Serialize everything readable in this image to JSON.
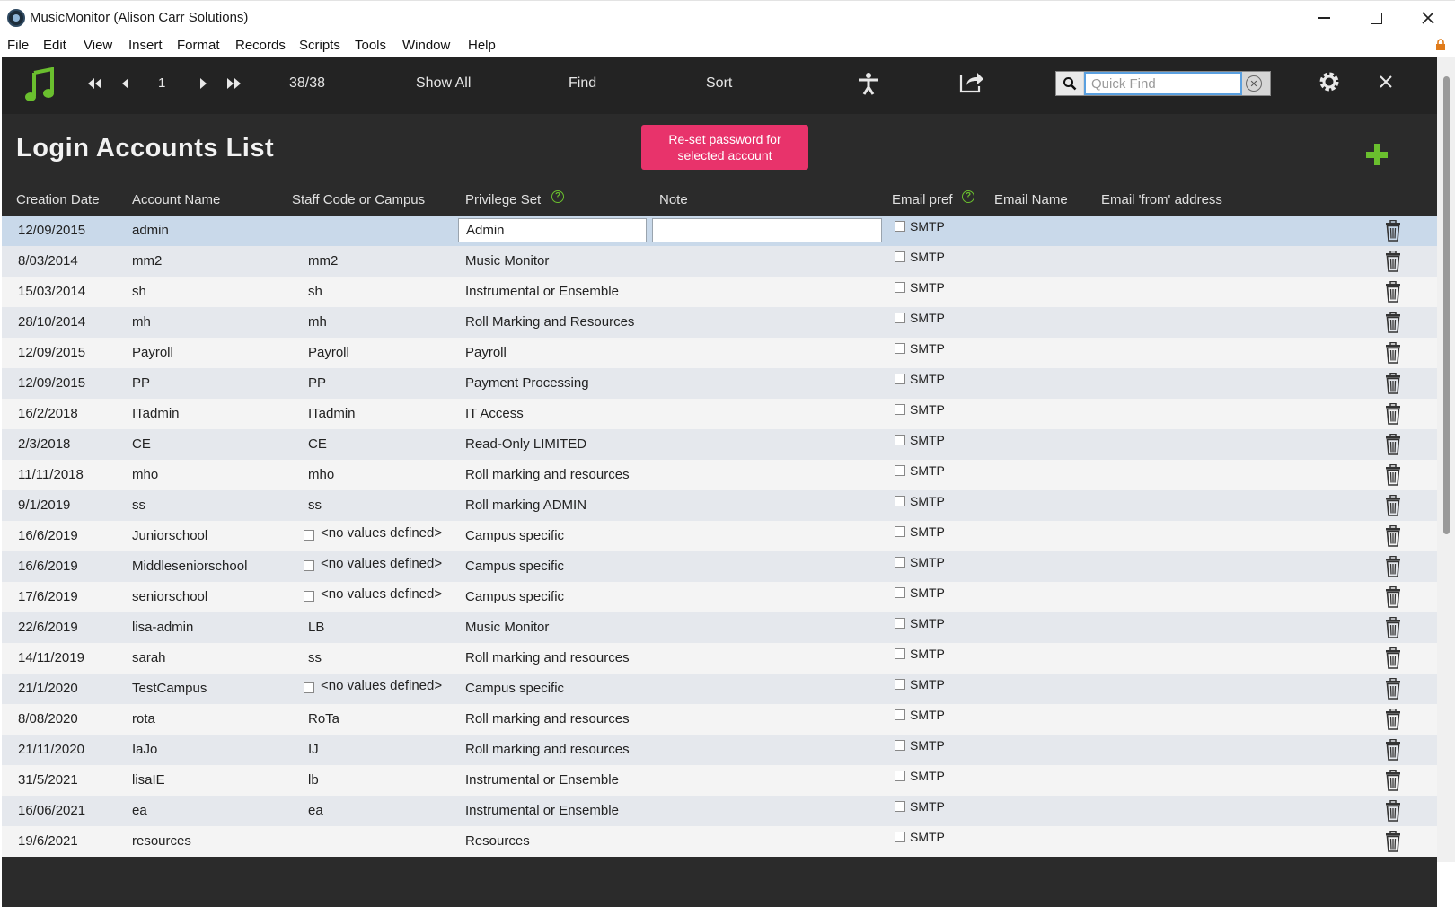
{
  "window": {
    "title": "MusicMonitor (Alison Carr Solutions)",
    "minimize": "minimize",
    "maximize": "maximize",
    "close": "close"
  },
  "menu": [
    "File",
    "Edit",
    "View",
    "Insert",
    "Format",
    "Records",
    "Scripts",
    "Tools",
    "Window",
    "Help"
  ],
  "toolbar": {
    "record_number": "1",
    "record_count": "38/38",
    "show_all": "Show All",
    "find": "Find",
    "sort": "Sort",
    "quick_find_placeholder": "Quick Find",
    "icons": [
      "music-note-icon",
      "first-record-icon",
      "previous-record-icon",
      "next-record-icon",
      "last-record-icon",
      "accessibility-icon",
      "share-icon",
      "search-icon",
      "clear-icon",
      "gear-icon",
      "close-icon"
    ],
    "accent_color": "#6abf2e"
  },
  "page": {
    "title": "Login Accounts List",
    "reset_button": "Re-set password for selected account",
    "reset_button_color": "#e8336b"
  },
  "columns": {
    "creation_date": "Creation Date",
    "account_name": "Account Name",
    "staff_code": "Staff Code or Campus",
    "privilege_set": "Privilege Set",
    "note": "Note",
    "email_pref": "Email pref",
    "email_name": "Email Name",
    "email_from": "Email 'from' address"
  },
  "rows": [
    {
      "date": "12/09/2015",
      "account": "admin",
      "staff": "",
      "staff_checkbox": false,
      "privilege": "Admin",
      "note": "",
      "email_pref": "SMTP",
      "selected": true
    },
    {
      "date": "8/03/2014",
      "account": "mm2",
      "staff": "mm2",
      "staff_checkbox": false,
      "privilege": "Music Monitor",
      "note": "",
      "email_pref": "SMTP"
    },
    {
      "date": "15/03/2014",
      "account": "sh",
      "staff": "sh",
      "staff_checkbox": false,
      "privilege": "Instrumental or Ensemble",
      "note": "",
      "email_pref": "SMTP"
    },
    {
      "date": "28/10/2014",
      "account": "mh",
      "staff": "mh",
      "staff_checkbox": false,
      "privilege": "Roll Marking and Resources",
      "note": "",
      "email_pref": "SMTP"
    },
    {
      "date": "12/09/2015",
      "account": "Payroll",
      "staff": "Payroll",
      "staff_checkbox": false,
      "privilege": "Payroll",
      "note": "",
      "email_pref": "SMTP"
    },
    {
      "date": "12/09/2015",
      "account": "PP",
      "staff": "PP",
      "staff_checkbox": false,
      "privilege": "Payment Processing",
      "note": "",
      "email_pref": "SMTP"
    },
    {
      "date": "16/2/2018",
      "account": "ITadmin",
      "staff": "ITadmin",
      "staff_checkbox": false,
      "privilege": "IT Access",
      "note": "",
      "email_pref": "SMTP"
    },
    {
      "date": "2/3/2018",
      "account": "CE",
      "staff": "CE",
      "staff_checkbox": false,
      "privilege": "Read-Only LIMITED",
      "note": "",
      "email_pref": "SMTP"
    },
    {
      "date": "11/11/2018",
      "account": "mho",
      "staff": "mho",
      "staff_checkbox": false,
      "privilege": "Roll marking and resources",
      "note": "",
      "email_pref": "SMTP"
    },
    {
      "date": "9/1/2019",
      "account": "ss",
      "staff": "ss",
      "staff_checkbox": false,
      "privilege": "Roll marking ADMIN",
      "note": "",
      "email_pref": "SMTP"
    },
    {
      "date": "16/6/2019",
      "account": "Juniorschool",
      "staff": "<no values defined>",
      "staff_checkbox": true,
      "privilege": "Campus specific",
      "note": "",
      "email_pref": "SMTP"
    },
    {
      "date": "16/6/2019",
      "account": "Middleseniorschool",
      "staff": "<no values defined>",
      "staff_checkbox": true,
      "privilege": "Campus specific",
      "note": "",
      "email_pref": "SMTP"
    },
    {
      "date": "17/6/2019",
      "account": "seniorschool",
      "staff": "<no values defined>",
      "staff_checkbox": true,
      "privilege": "Campus specific",
      "note": "",
      "email_pref": "SMTP"
    },
    {
      "date": "22/6/2019",
      "account": "lisa-admin",
      "staff": "LB",
      "staff_checkbox": false,
      "privilege": "Music Monitor",
      "note": "",
      "email_pref": "SMTP"
    },
    {
      "date": "14/11/2019",
      "account": "sarah",
      "staff": "ss",
      "staff_checkbox": false,
      "privilege": "Roll marking and resources",
      "note": "",
      "email_pref": "SMTP"
    },
    {
      "date": "21/1/2020",
      "account": "TestCampus",
      "staff": "<no values defined>",
      "staff_checkbox": true,
      "privilege": "Campus specific",
      "note": "",
      "email_pref": "SMTP"
    },
    {
      "date": "8/08/2020",
      "account": "rota",
      "staff": "RoTa",
      "staff_checkbox": false,
      "privilege": "Roll marking and resources",
      "note": "",
      "email_pref": "SMTP"
    },
    {
      "date": "21/11/2020",
      "account": "IaJo",
      "staff": "IJ",
      "staff_checkbox": false,
      "privilege": "Roll marking and resources",
      "note": "",
      "email_pref": "SMTP"
    },
    {
      "date": "31/5/2021",
      "account": "lisaIE",
      "staff": "lb",
      "staff_checkbox": false,
      "privilege": "Instrumental or Ensemble",
      "note": "",
      "email_pref": "SMTP"
    },
    {
      "date": "16/06/2021",
      "account": "ea",
      "staff": "ea",
      "staff_checkbox": false,
      "privilege": "Instrumental or Ensemble",
      "note": "",
      "email_pref": "SMTP"
    },
    {
      "date": "19/6/2021",
      "account": "resources",
      "staff": "",
      "staff_checkbox": false,
      "privilege": "Resources",
      "note": "",
      "email_pref": "SMTP"
    }
  ]
}
